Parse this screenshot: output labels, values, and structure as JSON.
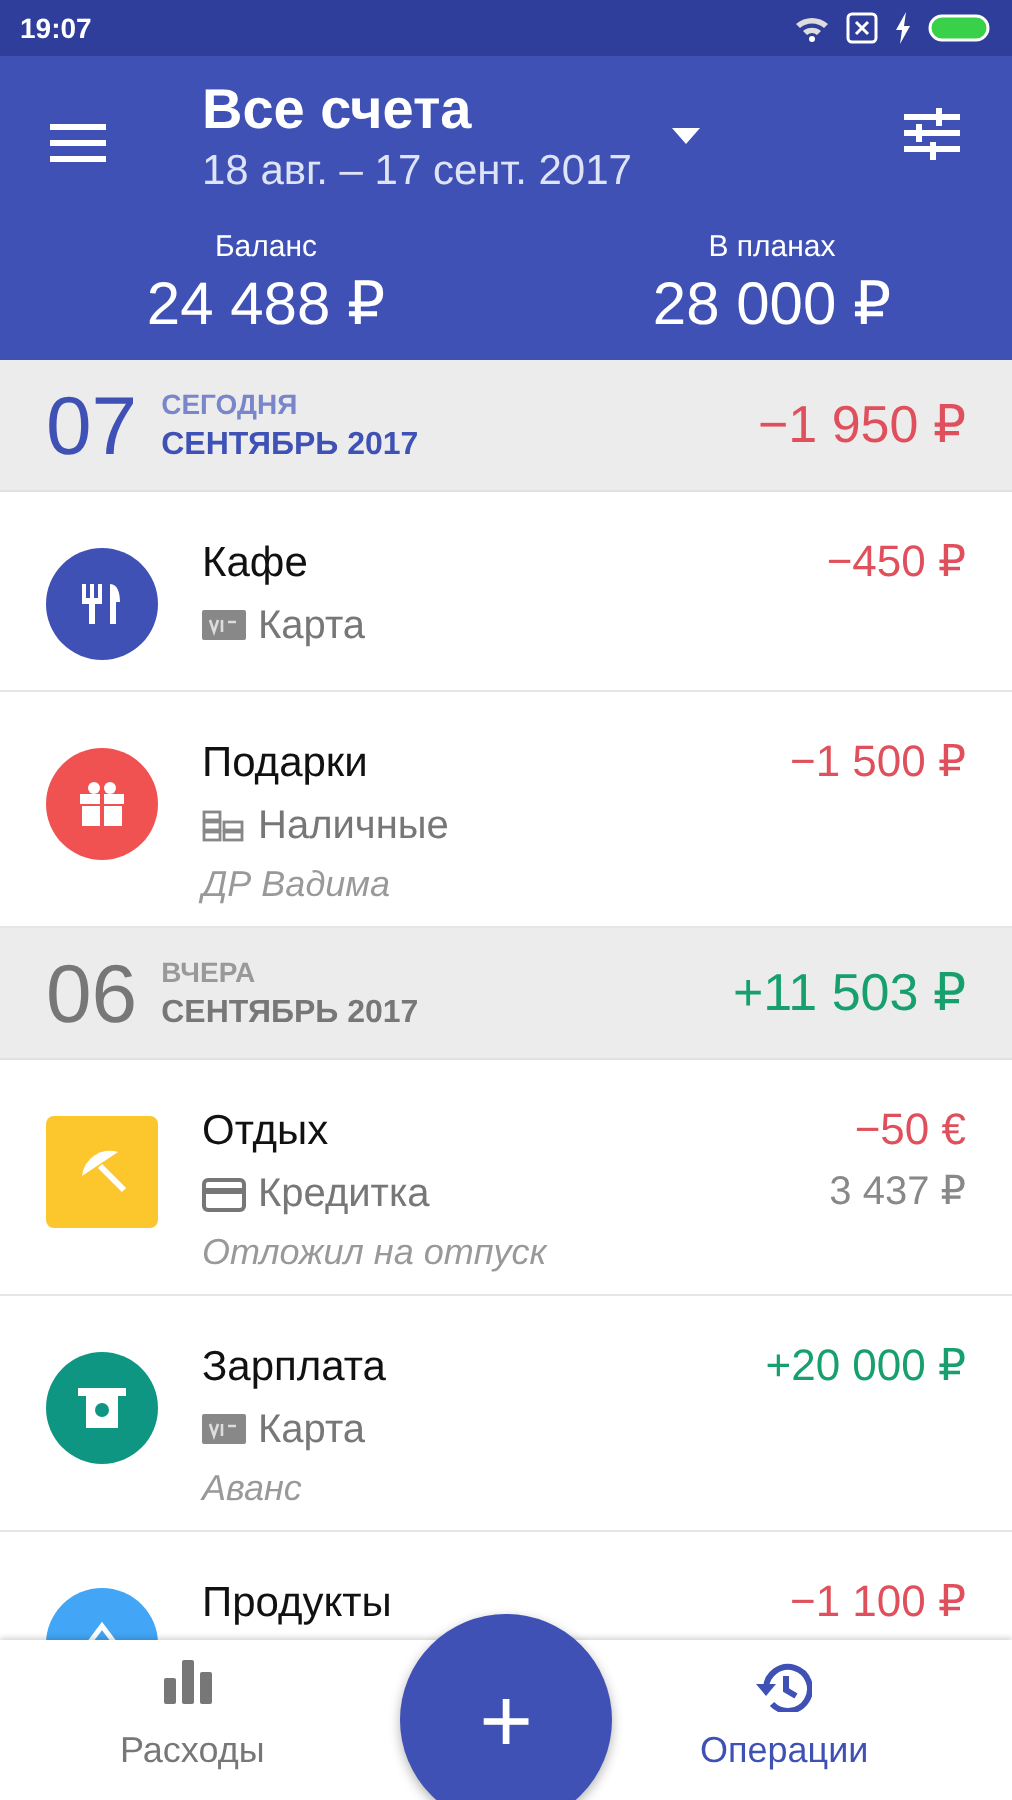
{
  "status_bar": {
    "time": "19:07"
  },
  "header": {
    "title": "Все счета",
    "period": "18 авг. – 17 сент. 2017",
    "summary": [
      {
        "label": "Баланс",
        "value": "24 488 ₽"
      },
      {
        "label": "В планах",
        "value": "28 000 ₽"
      }
    ]
  },
  "days": [
    {
      "day": "07",
      "label": "СЕГОДНЯ",
      "month": "СЕНТЯБРЬ 2017",
      "total": {
        "text": "−1 950 ₽",
        "kind": "expense"
      },
      "current": true,
      "transactions": [
        {
          "category": "Кафе",
          "kind": "cutlery",
          "color": "#3f51b5",
          "account": {
            "name": "Карта",
            "kind": "card"
          },
          "amount": {
            "text": "−450 ₽",
            "kind": "expense"
          }
        },
        {
          "category": "Подарки",
          "kind": "gift",
          "color": "#f05252",
          "account": {
            "name": "Наличные",
            "kind": "cash"
          },
          "note": "ДР Вадима",
          "amount": {
            "text": "−1 500 ₽",
            "kind": "expense"
          }
        }
      ]
    },
    {
      "day": "06",
      "label": "ВЧЕРА",
      "month": "СЕНТЯБРЬ 2017",
      "total": {
        "text": "+11 503 ₽",
        "kind": "income"
      },
      "current": false,
      "transactions": [
        {
          "category": "Отдых",
          "kind": "umbrella",
          "color": "#fbc72c",
          "account": {
            "name": "Кредитка",
            "kind": "credit"
          },
          "note": "Отложил на отпуск",
          "amount": {
            "text": "−50 €",
            "kind": "expense"
          },
          "converted": "3 437 ₽"
        },
        {
          "category": "Зарплата",
          "kind": "atm",
          "color": "#0f9682",
          "account": {
            "name": "Карта",
            "kind": "card"
          },
          "note": "Аванс",
          "amount": {
            "text": "+20 000 ₽",
            "kind": "income"
          }
        },
        {
          "category": "Продукты",
          "kind": "basket",
          "color": "#42a5f5",
          "amount": {
            "text": "−1 100 ₽",
            "kind": "expense"
          }
        }
      ]
    }
  ],
  "bottom_nav": {
    "tabs": [
      {
        "label": "Расходы",
        "kind": "chart",
        "selected": false
      },
      {
        "label": "Операции",
        "kind": "history",
        "selected": true
      }
    ],
    "fab": {
      "label": "+"
    }
  }
}
